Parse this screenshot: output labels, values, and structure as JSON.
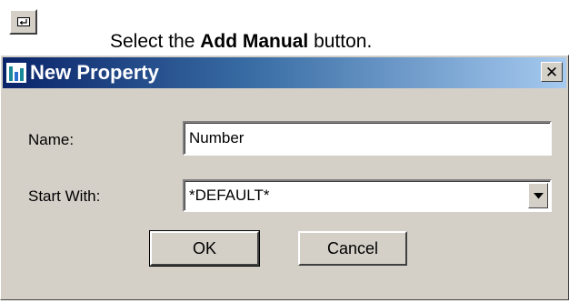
{
  "instruction": {
    "prefix": "Select the ",
    "bold": "Add Manual",
    "suffix": " button."
  },
  "toolbar_button": {
    "icon": "enter-arrow-icon"
  },
  "dialog": {
    "title": "New Property",
    "close_icon": "close-icon",
    "name_label": "Name:",
    "name_value": "Number",
    "start_with_label": "Start With:",
    "start_with_value": "*DEFAULT*",
    "ok_label": "OK",
    "cancel_label": "Cancel"
  },
  "colors": {
    "titlebar_start": "#0a246a",
    "titlebar_end": "#a6caf0",
    "dialog_face": "#d4d0c8"
  }
}
